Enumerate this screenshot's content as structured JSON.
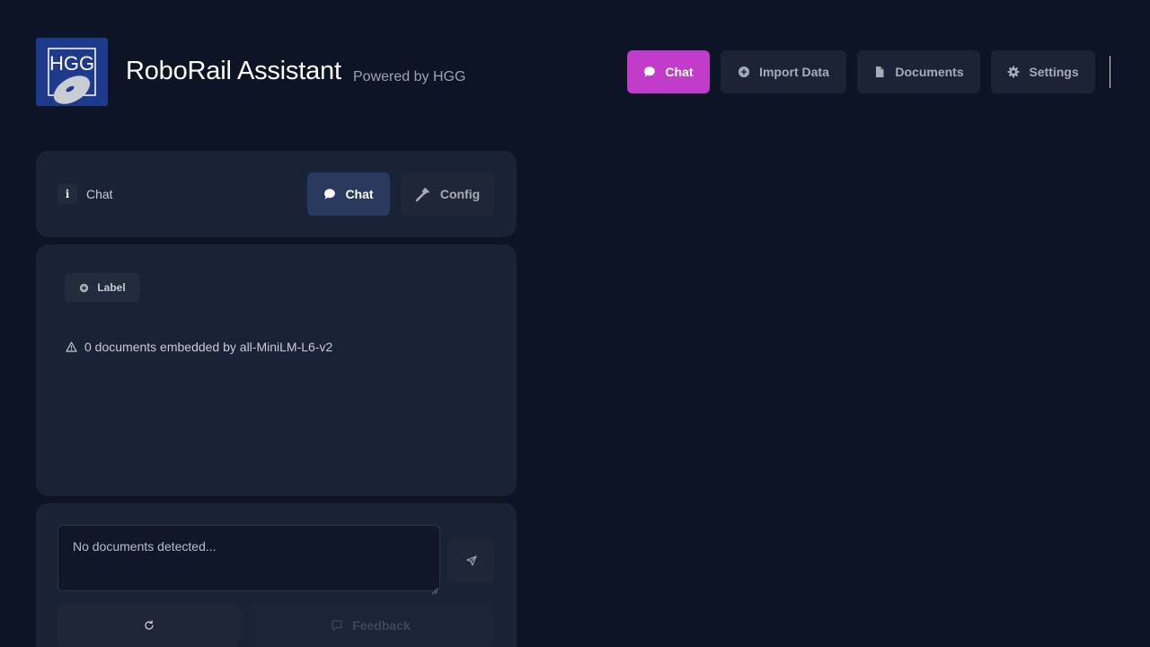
{
  "header": {
    "logo_text": "HGG",
    "title": "RoboRail Assistant",
    "subtitle": "Powered by HGG"
  },
  "nav": {
    "chat": {
      "label": "Chat",
      "icon": "chat-bubble-icon"
    },
    "import": {
      "label": "Import Data",
      "icon": "plus-circle-icon"
    },
    "documents": {
      "label": "Documents",
      "icon": "file-icon"
    },
    "settings": {
      "label": "Settings",
      "icon": "gear-icon"
    }
  },
  "chat_panel": {
    "info_label": "Chat",
    "info_icon": "i",
    "tabs": {
      "chat": {
        "label": "Chat",
        "icon": "chat-bubble-icon"
      },
      "config": {
        "label": "Config",
        "icon": "hammer-icon"
      }
    }
  },
  "content": {
    "label_button": "Label",
    "status_text": "0 documents embedded by all-MiniLM-L6-v2"
  },
  "input": {
    "placeholder": "No documents detected...",
    "feedback_label": "Feedback"
  },
  "colors": {
    "background": "#0c1425",
    "panel": "#1a2235",
    "accent": "#c13dc9",
    "active_tab": "#2a3a5e"
  }
}
